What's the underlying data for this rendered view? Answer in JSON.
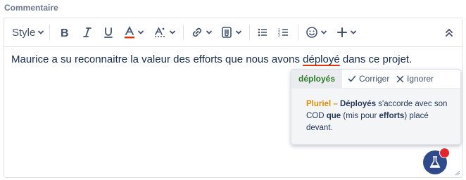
{
  "field": {
    "label": "Commentaire"
  },
  "toolbar": {
    "style_label": "Style",
    "icons": [
      "bold-icon",
      "italic-icon",
      "underline-icon",
      "text-color-icon",
      "text-format-icon",
      "link-icon",
      "attachment-icon",
      "bullet-list-icon",
      "numbered-list-icon",
      "emoji-icon",
      "plus-icon",
      "collapse-icon"
    ],
    "text_color_accent": "#de350b"
  },
  "editor": {
    "text_before": "Maurice a su reconnaitre la valeur des efforts que nous avons ",
    "error_word": "déployé",
    "text_after": " dans ce projet."
  },
  "grammar_popup": {
    "suggestion": "déployés",
    "correct_label": "Corriger",
    "ignore_label": "Ignorer",
    "explanation": {
      "kind": "Pluriel –",
      "p1": " ",
      "b1": "Déployés",
      "p2": " s'accorde avec son COD ",
      "b2": "que",
      "p3": " (mis pour ",
      "b3": "efforts",
      "p4": ") placé devant."
    }
  },
  "colors": {
    "suggestion_green": "#2d7d2a",
    "kind_orange": "#d98e0b",
    "error_red": "#de350b",
    "fab_blue": "#2f4a8c",
    "badge_red": "#e4262c"
  }
}
